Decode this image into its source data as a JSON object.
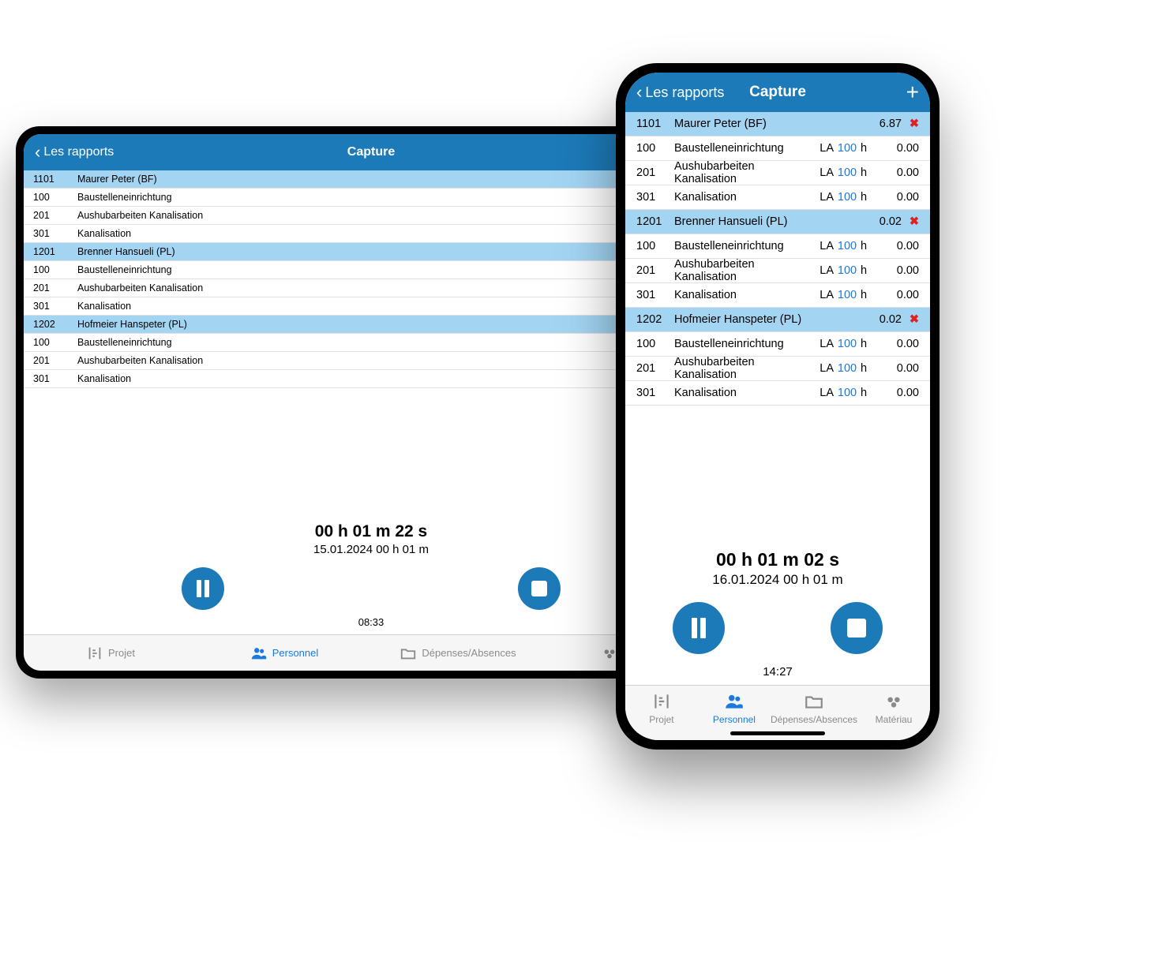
{
  "header": {
    "back": "Les rapports",
    "title": "Capture",
    "add": "+"
  },
  "tablet": {
    "groups": [
      {
        "person": {
          "code": "1101",
          "name": "Maurer Peter (BF)"
        },
        "tasks": [
          {
            "code": "100",
            "name": "Baustelleneinrichtung"
          },
          {
            "code": "201",
            "name": "Aushubarbeiten Kanalisation"
          },
          {
            "code": "301",
            "name": "Kanalisation"
          }
        ]
      },
      {
        "person": {
          "code": "1201",
          "name": "Brenner Hansueli (PL)"
        },
        "tasks": [
          {
            "code": "100",
            "name": "Baustelleneinrichtung"
          },
          {
            "code": "201",
            "name": "Aushubarbeiten Kanalisation"
          },
          {
            "code": "301",
            "name": "Kanalisation"
          }
        ]
      },
      {
        "person": {
          "code": "1202",
          "name": "Hofmeier Hanspeter (PL)"
        },
        "tasks": [
          {
            "code": "100",
            "name": "Baustelleneinrichtung"
          },
          {
            "code": "201",
            "name": "Aushubarbeiten Kanalisation"
          },
          {
            "code": "301",
            "name": "Kanalisation"
          }
        ]
      }
    ],
    "timer": {
      "main": "00 h 01 m 22 s",
      "sub": "15.01.2024 00 h 01 m",
      "clock": "08:33"
    }
  },
  "phone": {
    "groups": [
      {
        "person": {
          "code": "1101",
          "name": "Maurer Peter (BF)",
          "amount": "6.87",
          "del": "✖"
        },
        "tasks": [
          {
            "code": "100",
            "name": "Baustelleneinrichtung",
            "la": "LA",
            "val": "100",
            "unit": "h",
            "amount": "0.00"
          },
          {
            "code": "201",
            "name": "Aushubarbeiten Kanalisation",
            "la": "LA",
            "val": "100",
            "unit": "h",
            "amount": "0.00"
          },
          {
            "code": "301",
            "name": "Kanalisation",
            "la": "LA",
            "val": "100",
            "unit": "h",
            "amount": "0.00"
          }
        ]
      },
      {
        "person": {
          "code": "1201",
          "name": "Brenner Hansueli (PL)",
          "amount": "0.02",
          "del": "✖"
        },
        "tasks": [
          {
            "code": "100",
            "name": "Baustelleneinrichtung",
            "la": "LA",
            "val": "100",
            "unit": "h",
            "amount": "0.00"
          },
          {
            "code": "201",
            "name": "Aushubarbeiten Kanalisation",
            "la": "LA",
            "val": "100",
            "unit": "h",
            "amount": "0.00"
          },
          {
            "code": "301",
            "name": "Kanalisation",
            "la": "LA",
            "val": "100",
            "unit": "h",
            "amount": "0.00"
          }
        ]
      },
      {
        "person": {
          "code": "1202",
          "name": "Hofmeier Hanspeter (PL)",
          "amount": "0.02",
          "del": "✖"
        },
        "tasks": [
          {
            "code": "100",
            "name": "Baustelleneinrichtung",
            "la": "LA",
            "val": "100",
            "unit": "h",
            "amount": "0.00"
          },
          {
            "code": "201",
            "name": "Aushubarbeiten Kanalisation",
            "la": "LA",
            "val": "100",
            "unit": "h",
            "amount": "0.00"
          },
          {
            "code": "301",
            "name": "Kanalisation",
            "la": "LA",
            "val": "100",
            "unit": "h",
            "amount": "0.00"
          }
        ]
      }
    ],
    "timer": {
      "main": "00 h 01 m 02 s",
      "sub": "16.01.2024 00 h 01 m",
      "clock": "14:27"
    }
  },
  "tabs": {
    "projet": "Projet",
    "personnel": "Personnel",
    "depenses": "Dépenses/Absences",
    "materiau": "Matériau"
  }
}
